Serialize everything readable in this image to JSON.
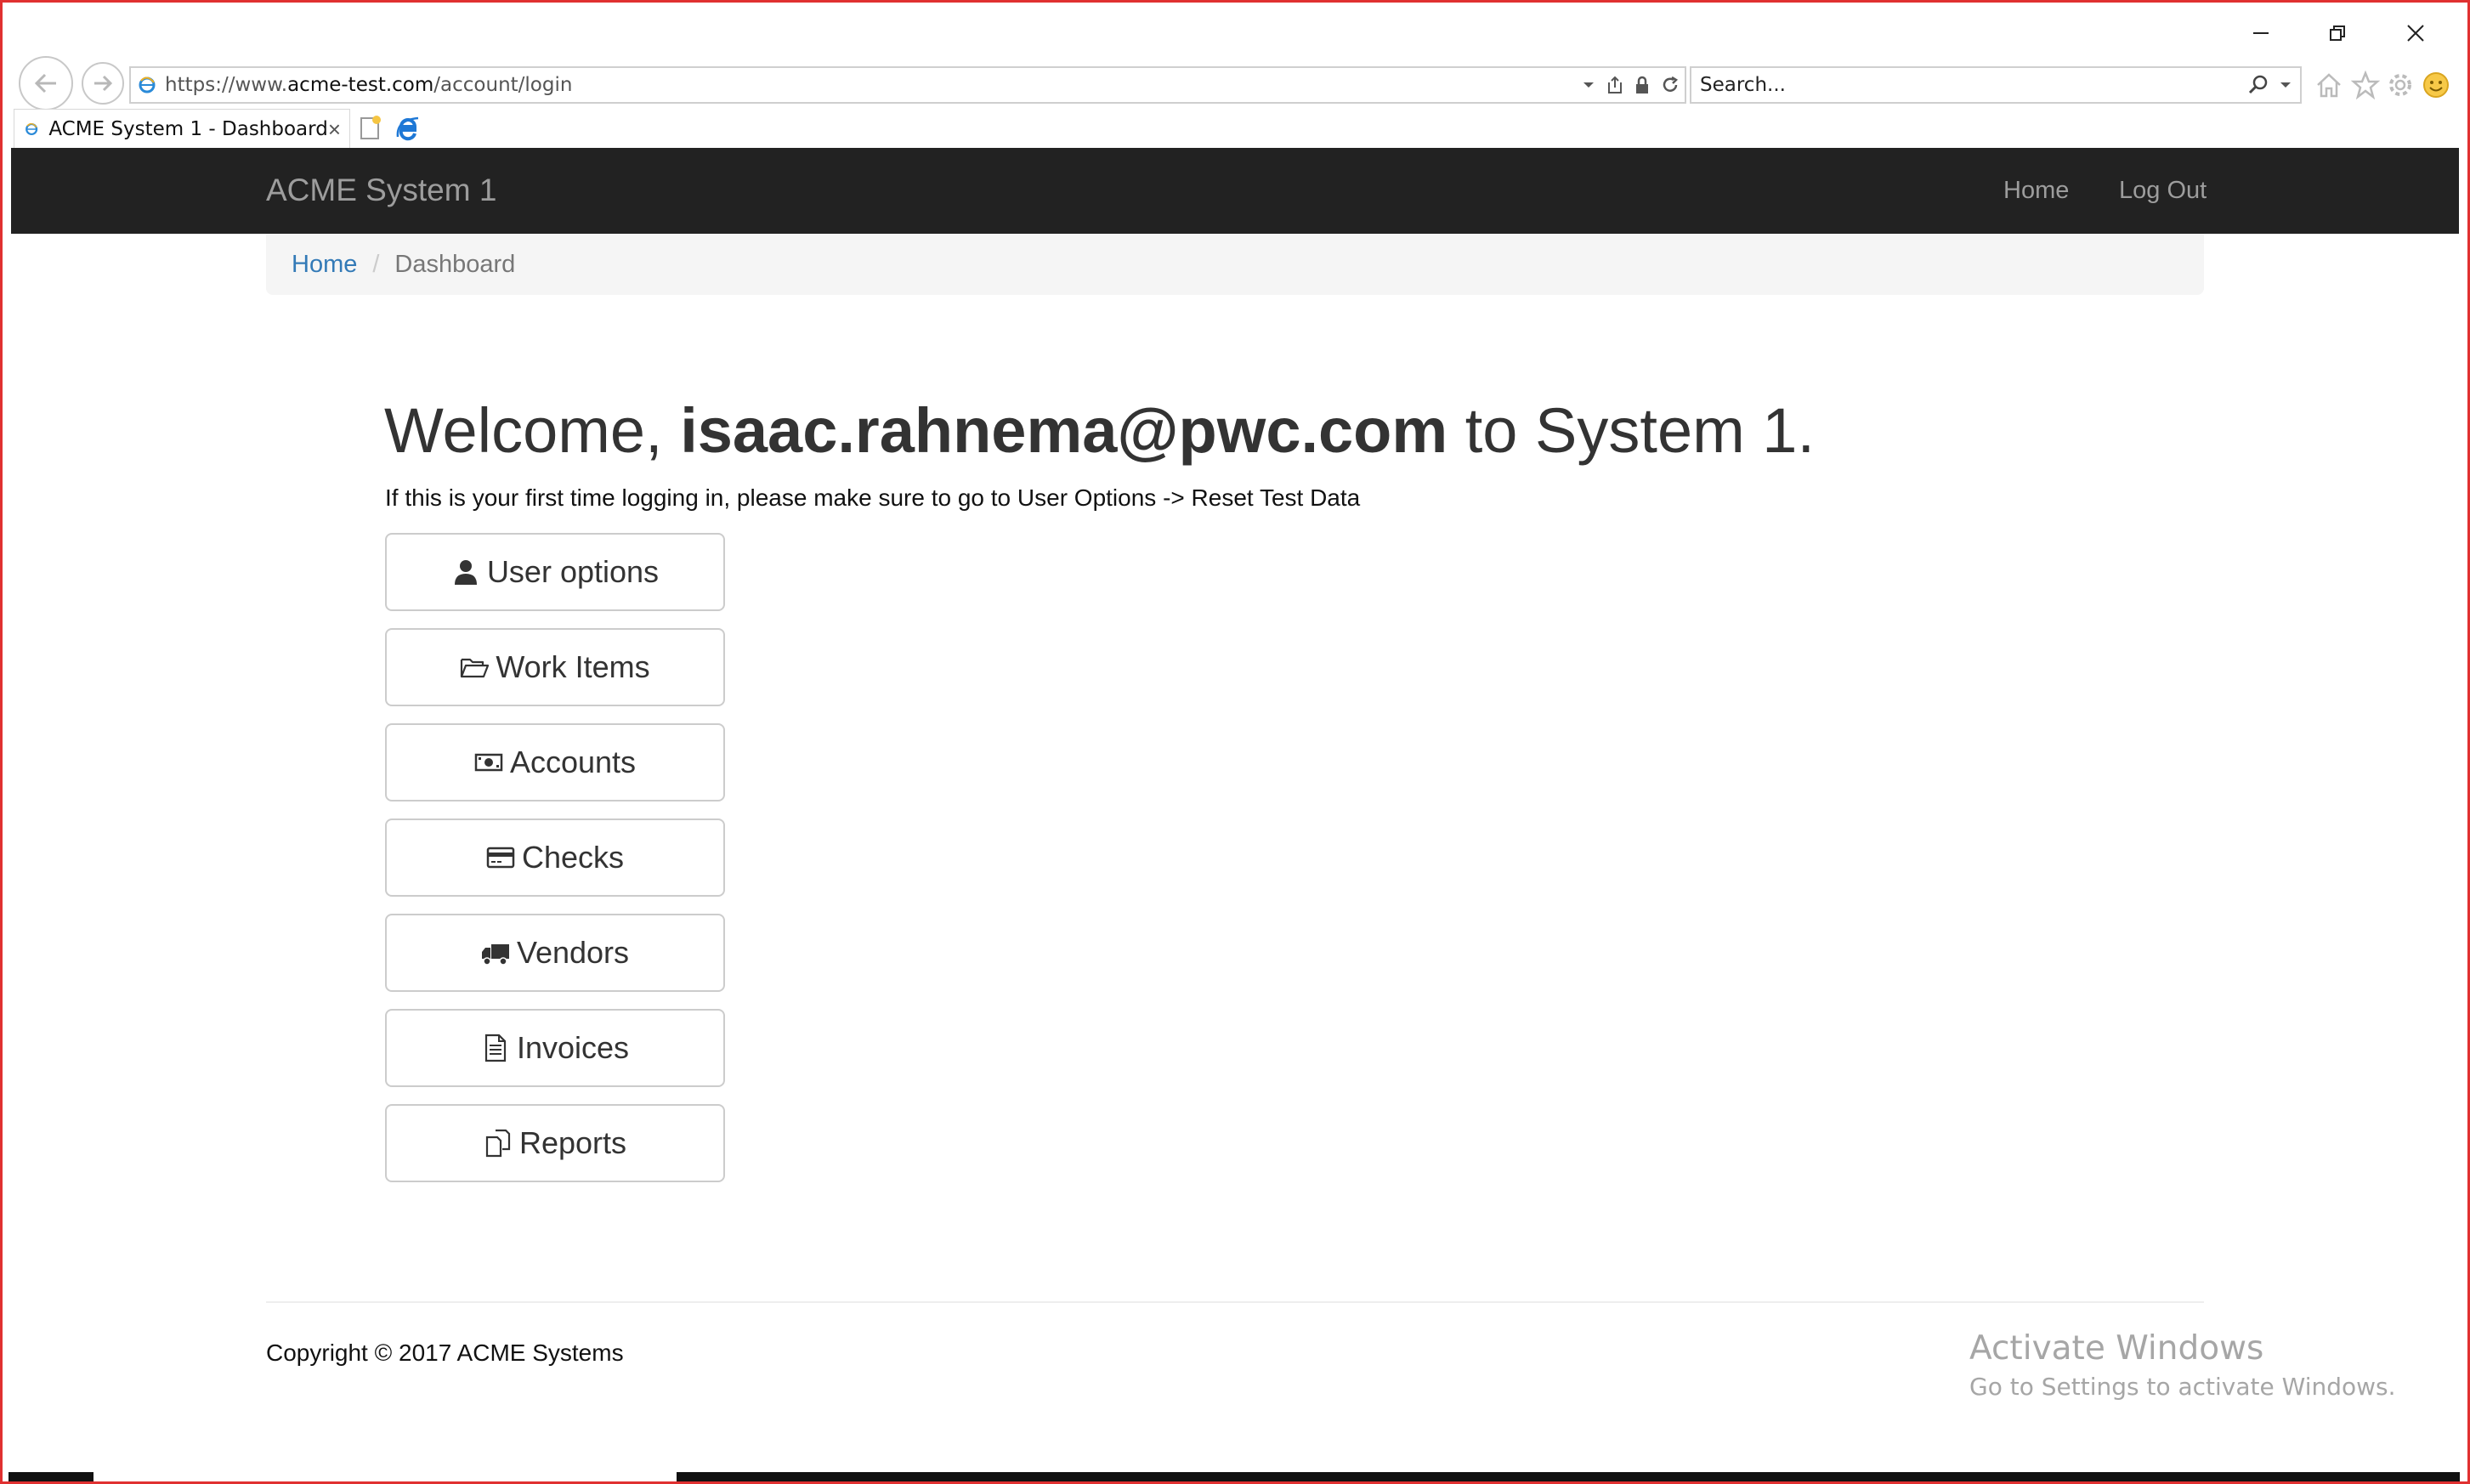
{
  "browser": {
    "address": {
      "prefix": "https://www.",
      "domain": "acme-test.com",
      "path": "/account/login"
    },
    "search_placeholder": "Search...",
    "tab": {
      "title": "ACME System 1 - Dashboard",
      "close": "×"
    }
  },
  "navbar": {
    "brand": "ACME System 1",
    "links": {
      "home": "Home",
      "logout": "Log Out"
    }
  },
  "breadcrumb": {
    "home": "Home",
    "separator": "/",
    "current": "Dashboard"
  },
  "welcome": {
    "prefix": "Welcome, ",
    "user": "isaac.rahnema@pwc.com",
    "suffix": " to System 1.",
    "note": "If this is your first time logging in, please make sure to go to User Options -> Reset Test Data"
  },
  "buttons": {
    "user_options": "User options",
    "work_items": "Work Items",
    "accounts": "Accounts",
    "checks": "Checks",
    "vendors": "Vendors",
    "invoices": "Invoices",
    "reports": "Reports"
  },
  "footer": {
    "copyright": "Copyright © 2017 ACME Systems"
  },
  "watermark": {
    "title": "Activate Windows",
    "subtitle": "Go to Settings to activate Windows."
  },
  "colors": {
    "navbar_bg": "#222222",
    "link": "#337ab7",
    "breadcrumb_bg": "#f5f5f5",
    "frame_border": "#e03030"
  }
}
